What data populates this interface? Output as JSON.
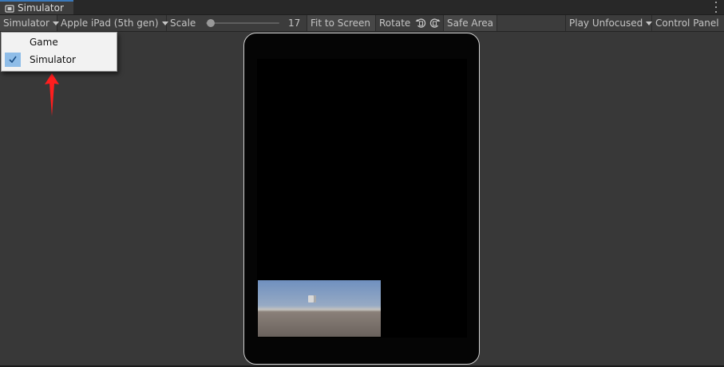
{
  "window": {
    "tab_title": "Simulator",
    "tab_icon": "simulator-icon",
    "menu_icon": "vertical-ellipsis-icon"
  },
  "toolbar": {
    "view_dropdown_label": "Simulator",
    "device_dropdown_label": "Apple iPad (5th gen)",
    "scale_label": "Scale",
    "scale_value": "17",
    "fit_to_screen_label": "Fit to Screen",
    "rotate_label": "Rotate",
    "rotate_left_icon": "rotate-left-icon",
    "rotate_right_icon": "rotate-right-icon",
    "safe_area_label": "Safe Area",
    "play_mode_label": "Play Unfocused",
    "control_panel_label": "Control Panel"
  },
  "view_menu": {
    "items": [
      {
        "label": "Game",
        "checked": false
      },
      {
        "label": "Simulator",
        "checked": true
      }
    ]
  },
  "colors": {
    "accent_tab": "#3a79bb",
    "menu_check_highlight": "#8fbde8",
    "annotation_arrow": "#ff1e1e"
  }
}
